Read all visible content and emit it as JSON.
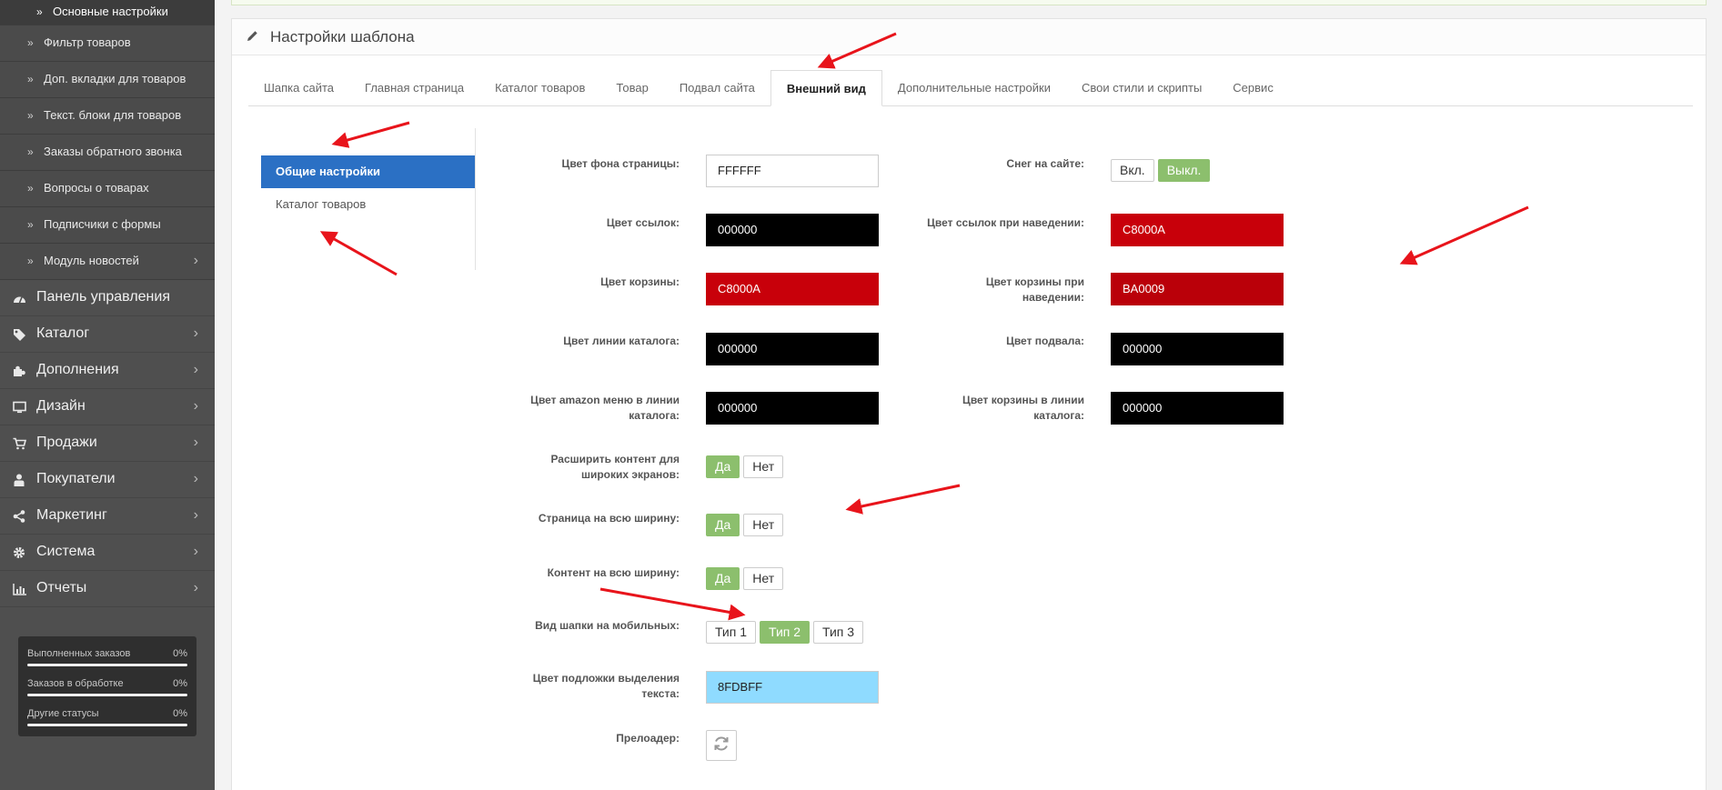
{
  "sidebar": {
    "sub_items": [
      {
        "label": "Основные настройки"
      },
      {
        "label": "Фильтр товаров"
      },
      {
        "label": "Доп. вкладки для товаров"
      },
      {
        "label": "Текст. блоки для товаров"
      },
      {
        "label": "Заказы обратного звонка"
      },
      {
        "label": "Вопросы о товарах"
      },
      {
        "label": "Подписчики с формы"
      },
      {
        "label": "Модуль новостей"
      }
    ],
    "main_items": [
      {
        "label": "Панель управления",
        "icon": "dashboard-icon"
      },
      {
        "label": "Каталог",
        "icon": "tags-icon"
      },
      {
        "label": "Дополнения",
        "icon": "puzzle-icon"
      },
      {
        "label": "Дизайн",
        "icon": "monitor-icon"
      },
      {
        "label": "Продажи",
        "icon": "cart-icon"
      },
      {
        "label": "Покупатели",
        "icon": "user-icon"
      },
      {
        "label": "Маркетинг",
        "icon": "share-icon"
      },
      {
        "label": "Система",
        "icon": "gear-icon"
      },
      {
        "label": "Отчеты",
        "icon": "bar-chart-icon"
      }
    ],
    "stats": [
      {
        "label": "Выполненных заказов",
        "value": "0%",
        "progress": 0
      },
      {
        "label": "Заказов в обработке",
        "value": "0%",
        "progress": 0
      },
      {
        "label": "Другие статусы",
        "value": "0%",
        "progress": 0
      }
    ]
  },
  "panel": {
    "title": "Настройки шаблона",
    "tabs": [
      {
        "label": "Шапка сайта"
      },
      {
        "label": "Главная страница"
      },
      {
        "label": "Каталог товаров"
      },
      {
        "label": "Товар"
      },
      {
        "label": "Подвал сайта"
      },
      {
        "label": "Внешний вид"
      },
      {
        "label": "Дополнительные настройки"
      },
      {
        "label": "Свои стили и скрипты"
      },
      {
        "label": "Сервис"
      }
    ],
    "active_tab": "Внешний вид",
    "left_menu": [
      {
        "label": "Общие настройки"
      },
      {
        "label": "Каталог товаров"
      }
    ]
  },
  "form": {
    "page_bg_label": "Цвет фона страницы:",
    "page_bg_value": "FFFFFF",
    "page_bg_color": "#FFFFFF",
    "links_label": "Цвет ссылок:",
    "links_value": "000000",
    "links_color": "#000000",
    "cart_label": "Цвет корзины:",
    "cart_value": "C8000A",
    "cart_color": "#C8000A",
    "catalog_line_label": "Цвет линии каталога:",
    "catalog_line_value": "000000",
    "catalog_line_color": "#000000",
    "amazon_label_1": "Цвет amazon меню в линии",
    "amazon_label_2": "каталога:",
    "amazon_value": "000000",
    "amazon_color": "#000000",
    "wide_label_1": "Расширить контент для",
    "wide_label_2": "широких экранов:",
    "wide_yes": "Да",
    "wide_no": "Нет",
    "full_page_label": "Страница на всю ширину:",
    "full_page_yes": "Да",
    "full_page_no": "Нет",
    "full_content_label": "Контент на всю ширину:",
    "full_content_yes": "Да",
    "full_content_no": "Нет",
    "mobile_header_label": "Вид шапки на мобильных:",
    "mobile_types": [
      "Тип 1",
      "Тип 2",
      "Тип 3"
    ],
    "mobile_selected": "Тип 2",
    "selection_label_1": "Цвет подложки выделения",
    "selection_label_2": "текста:",
    "selection_value": "8FDBFF",
    "selection_color": "#8FDBFF",
    "preloader_label": "Прелоадер:",
    "snow_label": "Снег на сайте:",
    "snow_on": "Вкл.",
    "snow_off": "Выкл.",
    "links_hover_label": "Цвет ссылок при наведении:",
    "links_hover_value": "C8000A",
    "links_hover_color": "#C8000A",
    "cart_hover_label_1": "Цвет корзины при",
    "cart_hover_label_2": "наведении:",
    "cart_hover_value": "BA0009",
    "cart_hover_color": "#BA0009",
    "footer_label": "Цвет подвала:",
    "footer_value": "000000",
    "footer_color": "#000000",
    "catalog_cart_label_1": "Цвет корзины в линии",
    "catalog_cart_label_2": "каталога:",
    "catalog_cart_value": "000000",
    "catalog_cart_color": "#000000"
  },
  "colors": {
    "accent_blue": "#2B70C4",
    "toggle_on": "#8CBF6D",
    "annotation_red": "#E8141B"
  }
}
